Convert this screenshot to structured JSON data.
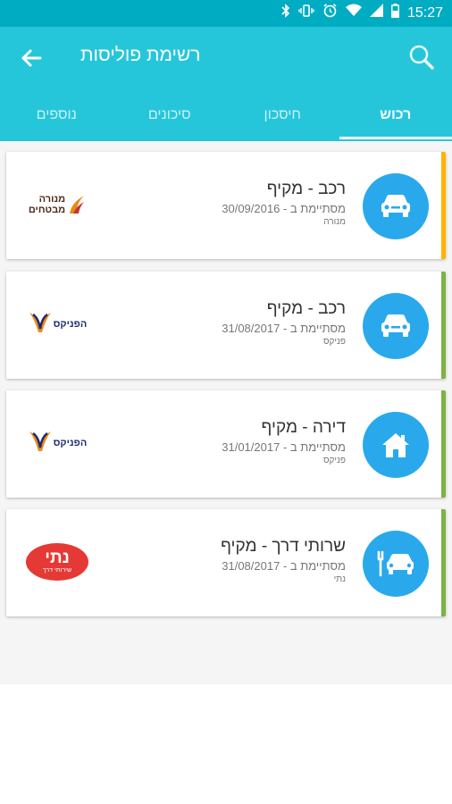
{
  "status_bar": {
    "time": "15:27",
    "icons": [
      "bluetooth-icon",
      "vibrate-icon",
      "alarm-icon",
      "wifi-icon",
      "signal-icon",
      "battery-icon"
    ]
  },
  "app_bar": {
    "title": "רשימת פוליסות",
    "back_icon": "arrow-back-icon",
    "search_icon": "search-icon",
    "color": "#26C6DA"
  },
  "tabs": [
    {
      "label": "רכוש",
      "active": true
    },
    {
      "label": "חיסכון",
      "active": false
    },
    {
      "label": "סיכונים",
      "active": false
    },
    {
      "label": "נוספים",
      "active": false
    }
  ],
  "policies": [
    {
      "title": "רכב - מקיף",
      "expiry": "מסתיימת ב - 30/09/2016",
      "company": "מנורה",
      "icon": "car-icon",
      "accent": "#FFB300",
      "logo": {
        "type": "menora",
        "line1": "מנורה",
        "line2": "מבטחים"
      }
    },
    {
      "title": "רכב - מקיף",
      "expiry": "מסתיימת ב - 31/08/2017",
      "company": "פניקס",
      "icon": "car-icon",
      "accent": "#7CB342",
      "logo": {
        "type": "phoenix",
        "text": "הפניקס"
      }
    },
    {
      "title": "דירה - מקיף",
      "expiry": "מסתיימת ב - 31/01/2017",
      "company": "פניקס",
      "icon": "home-icon",
      "accent": "#7CB342",
      "logo": {
        "type": "phoenix",
        "text": "הפניקס"
      }
    },
    {
      "title": "שרותי דרך - מקיף",
      "expiry": "מסתיימת ב - 31/08/2017",
      "company": "נתי",
      "icon": "car-service-icon",
      "accent": "#7CB342",
      "logo": {
        "type": "nati",
        "main": "נתי",
        "sub": "שירותי דרך"
      }
    }
  ]
}
